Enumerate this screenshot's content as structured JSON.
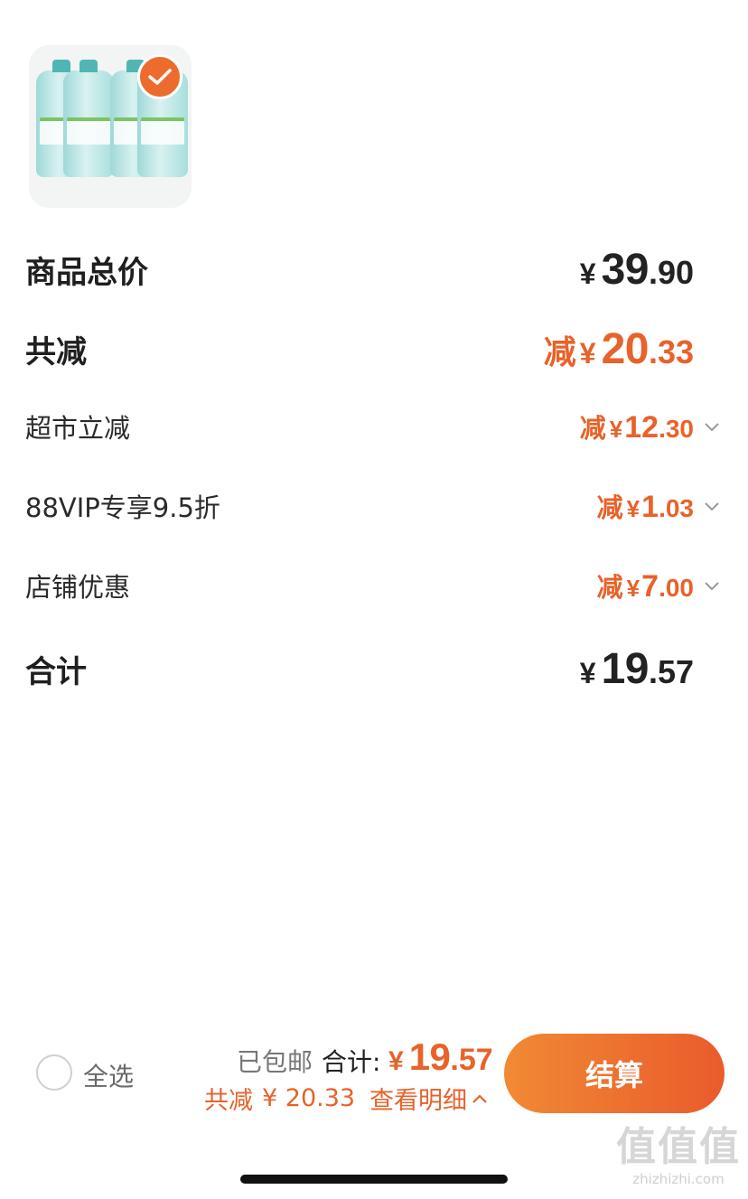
{
  "product": {
    "image_icon": "water-bottles-pack-icon",
    "selected": true,
    "check_icon": "checkmark-icon"
  },
  "summary": {
    "goods_total": {
      "label": "商品总价",
      "yen": "¥",
      "int": "39",
      "dec": ".90"
    },
    "total_discount": {
      "label": "共减",
      "prefix": "减",
      "yen": "¥",
      "int": "20",
      "dec": ".33"
    },
    "discounts": [
      {
        "label": "超市立减",
        "prefix": "减",
        "yen": "¥",
        "int": "12",
        "dec": ".30",
        "icon": "chevron-down-icon"
      },
      {
        "label": "88VIP专享9.5折",
        "prefix": "减",
        "yen": "¥",
        "int": "1",
        "dec": ".03",
        "icon": "chevron-down-icon"
      },
      {
        "label": "店铺优惠",
        "prefix": "减",
        "yen": "¥",
        "int": "7",
        "dec": ".00",
        "icon": "chevron-down-icon"
      }
    ],
    "grand_total": {
      "label": "合计",
      "yen": "¥",
      "int": "19",
      "dec": ".57"
    }
  },
  "bottom_bar": {
    "select_all": "全选",
    "shipping": "已包邮",
    "total_label": "合计:",
    "total": {
      "yen": "¥",
      "int": "19",
      "dec": ".57"
    },
    "discount_label": "共减",
    "discount_amount": "¥ 20.33",
    "detail_link": "查看明细",
    "detail_icon": "chevron-up-icon",
    "checkout_label": "结算"
  },
  "watermark": {
    "chars": "值值值",
    "url": "zhizhizhi.com"
  },
  "colors": {
    "accent": "#e8622a",
    "checkout_start": "#f08a34",
    "checkout_end": "#ea5b2c",
    "text": "#1f1f1f"
  }
}
